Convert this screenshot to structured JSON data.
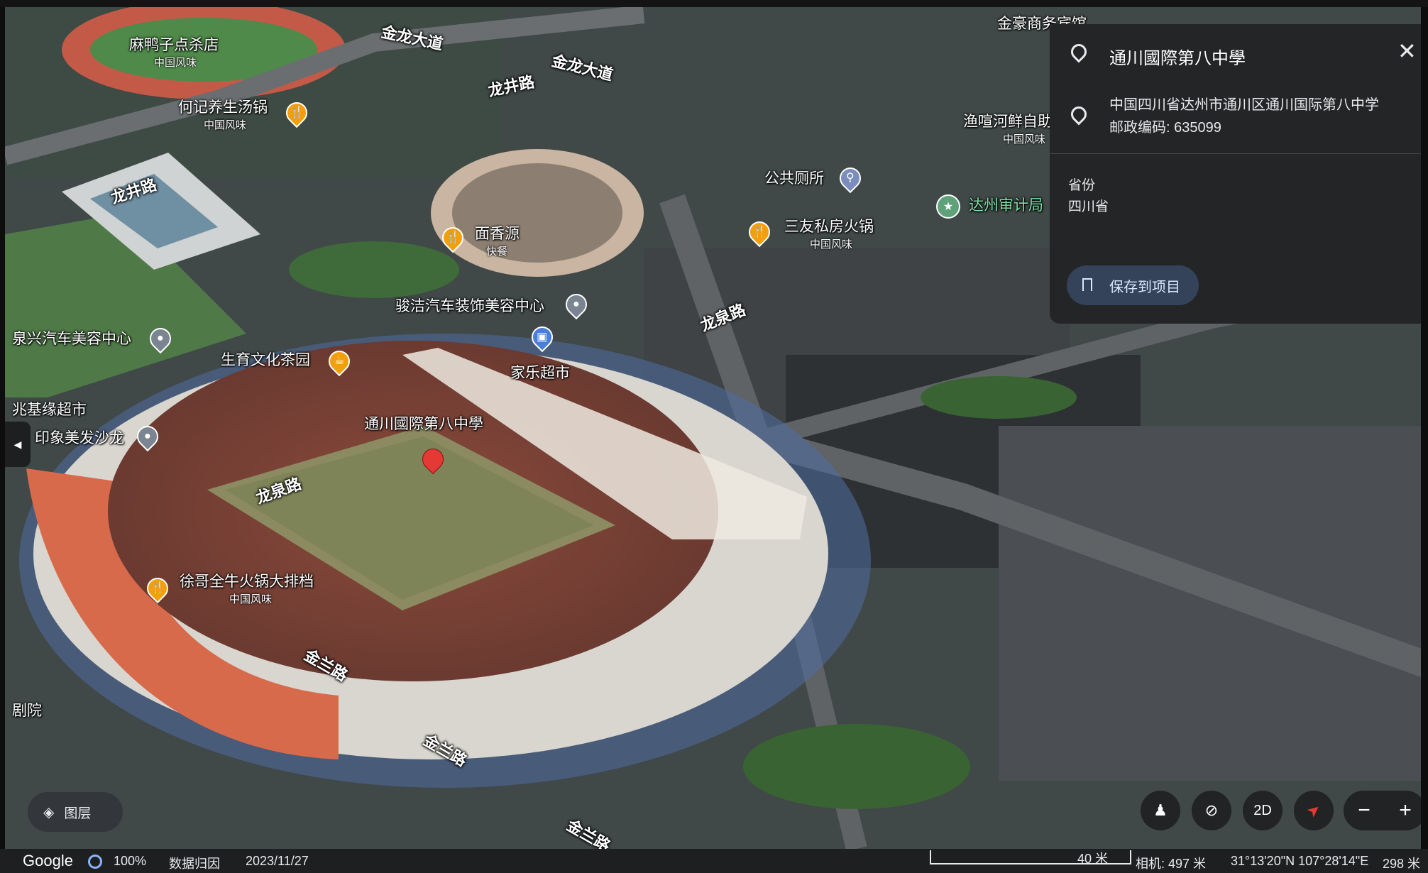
{
  "place": {
    "title": "通川國際第八中學",
    "address_line1": "中国四川省达州市通川区通川国际第八中学",
    "address_line2": "邮政编码: 635099",
    "attr_key": "省份",
    "attr_value": "四川省",
    "save_label": "保存到项目"
  },
  "map_labels": {
    "p1": "麻鸭子点杀店",
    "p1s": "中国风味",
    "p2": "何记养生汤锅",
    "p2s": "中国风味",
    "p3": "面香源",
    "p3s": "快餐",
    "p4": "骏洁汽车装饰美容中心",
    "p5": "泉兴汽车美容中心",
    "p6": "生育文化茶园",
    "p7": "家乐超市",
    "p8": "兆基缘超市",
    "p9": "印象美发沙龙",
    "p10": "徐哥全牛火锅大排档",
    "p10s": "中国风味",
    "p11": "公共厕所",
    "p12": "三友私房火锅",
    "p12s": "中国风味",
    "p13": "达州审计局",
    "p14": "渔喧河鲜自助",
    "p14s": "中国风味",
    "p15": "金豪商务宾馆",
    "p16": "通川國際第八中學",
    "p17": "剧院"
  },
  "roads": {
    "r1": "金龙大道",
    "r2": "金龙大道",
    "r3": "龙井路",
    "r4": "龙井路",
    "r5": "龙泉路",
    "r6": "龙泉路",
    "r7": "金兰路",
    "r8": "金兰路",
    "r9": "金兰路"
  },
  "controls": {
    "layers_label": "图层",
    "view_2d": "2D"
  },
  "footer": {
    "brand": "Google",
    "zoom": "100%",
    "data_attribution": "数据归因",
    "date": "2023/11/27",
    "scale": "40 米",
    "camera": "相机: 497 米",
    "coords": "31°13'20\"N 107°28'14\"E",
    "elevation": "298 米"
  },
  "colors": {
    "pin_red": "#e53935",
    "food_pin": "#f29f0d",
    "panel_bg": "#242527",
    "save_button": "#34425a"
  }
}
